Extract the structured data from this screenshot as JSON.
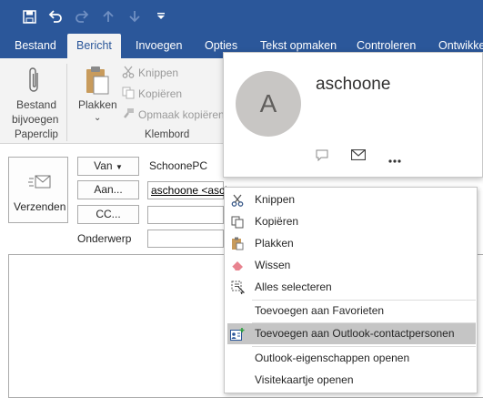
{
  "tabs": {
    "bestand": "Bestand",
    "bericht": "Bericht",
    "invoegen": "Invoegen",
    "opties": "Opties",
    "tekst_opmaken": "Tekst opmaken",
    "controleren": "Controleren",
    "ontwikkel": "Ontwikkel"
  },
  "ribbon": {
    "attach_line1": "Bestand",
    "attach_line2": "bijvoegen",
    "group_paperclip": "Paperclip",
    "paste_label": "Plakken",
    "cut": "Knippen",
    "copy": "Kopiëren",
    "format_copy": "Opmaak kopiëren",
    "group_clipboard": "Klembord"
  },
  "compose": {
    "send_label": "Verzenden",
    "from_label": "Van",
    "from_value": "SchoonePC",
    "to_label": "Aan...",
    "to_value": "aschoone <asch",
    "cc_label": "CC...",
    "subject_label": "Onderwerp"
  },
  "card": {
    "initial": "A",
    "name": "aschoone"
  },
  "context_menu": {
    "cut": "Knippen",
    "copy": "Kopiëren",
    "paste": "Plakken",
    "delete": "Wissen",
    "select_all": "Alles selecteren",
    "add_favorites": "Toevoegen aan Favorieten",
    "add_contacts": "Toevoegen aan Outlook-contactpersonen",
    "outlook_props": "Outlook-eigenschappen openen",
    "open_card": "Visitekaartje openen"
  },
  "colors": {
    "brand_blue": "#2b579a",
    "highlight": "#c5c5c5"
  }
}
